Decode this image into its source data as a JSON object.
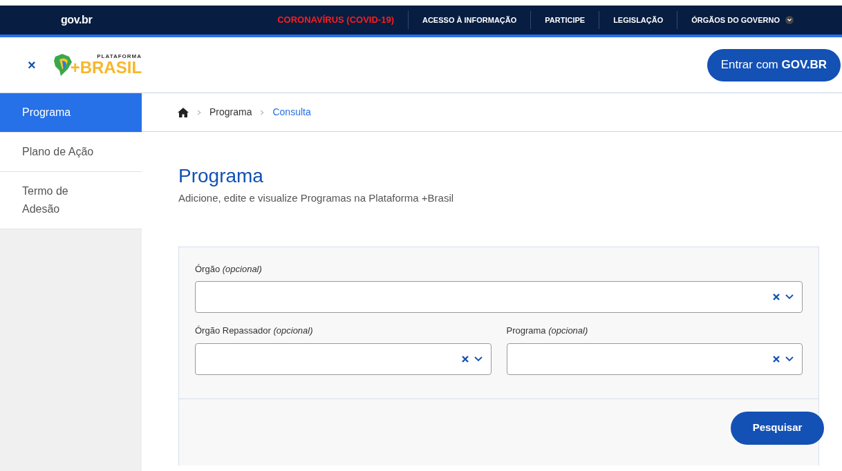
{
  "top_bar": {
    "logo": "gov.br",
    "links": [
      {
        "label": "CORONAVÍRUS (COVID-19)",
        "kind": "alert"
      },
      {
        "label": "ACESSO À INFORMAÇÃO",
        "kind": "link"
      },
      {
        "label": "PARTICIPE",
        "kind": "link"
      },
      {
        "label": "LEGISLAÇÃO",
        "kind": "link"
      },
      {
        "label": "ÓRGÃOS DO GOVERNO",
        "kind": "dropdown"
      }
    ]
  },
  "header": {
    "close": "×",
    "logo_small": "PLATAFORMA",
    "logo_big": "+BRASIL",
    "login": "Entrar com **GOV.BR**"
  },
  "sidebar": {
    "items": [
      {
        "label": "Programa",
        "selected": true
      },
      {
        "label": "Plano de Ação",
        "selected": false
      },
      {
        "label": "Termo de Adesão",
        "selected": false
      }
    ]
  },
  "breadcrumb": [
    {
      "label": "Programa",
      "current": false
    },
    {
      "label": "Consulta",
      "current": true
    }
  ],
  "page": {
    "title": "Programa",
    "subtitle": "Adicione, edite e visualize Programas na Plataforma +Brasil"
  },
  "form": {
    "rows": [
      [
        {
          "label": "Órgão *(opcional)*"
        }
      ],
      [
        {
          "label": "Órgão Repassador *(opcional)*"
        },
        {
          "label": "Programa *(opcional)*"
        }
      ]
    ],
    "submit": "Pesquisar"
  }
}
